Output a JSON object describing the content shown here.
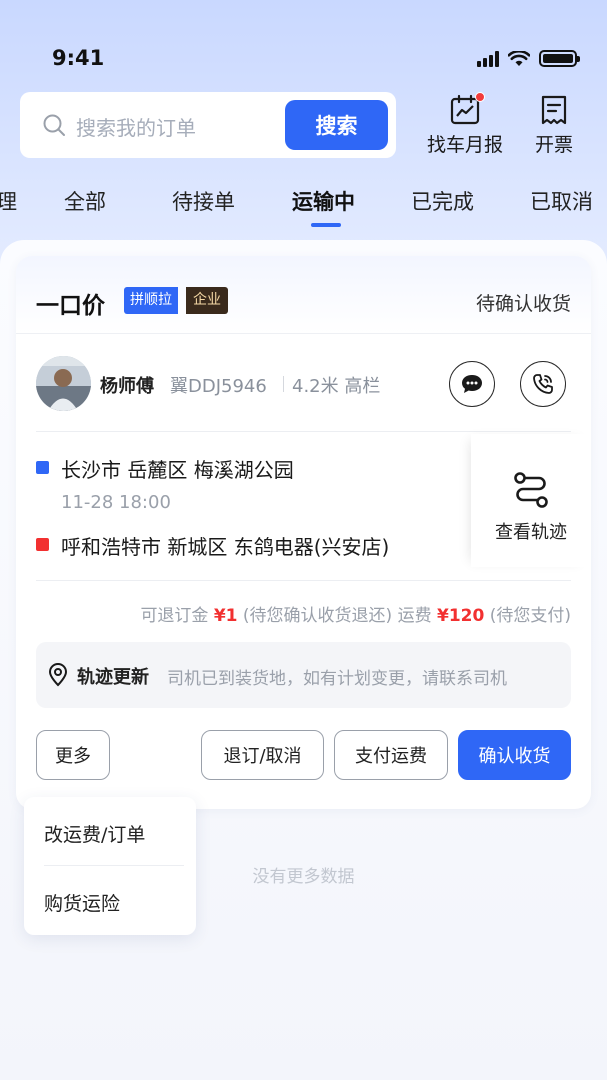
{
  "status_bar": {
    "time": "9:41"
  },
  "search": {
    "placeholder": "搜索我的订单",
    "button_label": "搜索"
  },
  "top_actions": [
    {
      "label": "找车月报",
      "icon": "chart-calendar-icon",
      "has_badge": true
    },
    {
      "label": "开票",
      "icon": "invoice-icon",
      "has_badge": false
    }
  ],
  "tabs": [
    {
      "label": "理",
      "active": false
    },
    {
      "label": "全部",
      "active": false
    },
    {
      "label": "待接单",
      "active": false
    },
    {
      "label": "运输中",
      "active": true
    },
    {
      "label": "已完成",
      "active": false
    },
    {
      "label": "已取消",
      "active": false
    }
  ],
  "order": {
    "price_type": "一口价",
    "badge_pin": "拼顺拉",
    "badge_enterprise": "企业",
    "status": "待确认收货",
    "driver": {
      "name": "杨师傅",
      "plate": "翼DDJ5946",
      "truck": "4.2米 高栏"
    },
    "route": {
      "origin": "长沙市 岳麓区 梅溪湖公园",
      "time": "11-28 18:00",
      "destination": "呼和浩特市 新城区 东鸽电器(兴安店)"
    },
    "track_label": "查看轨迹",
    "fees": {
      "refund_label": "可退订金",
      "refund_amount": "¥1",
      "refund_note": "(待您确认收货退还)",
      "freight_label": "运费",
      "freight_amount": "¥120",
      "freight_note": "(待您支付)"
    },
    "notice": {
      "title": "轨迹更新",
      "text": "司机已到装货地，如有计划变更，请联系司机"
    },
    "buttons": {
      "more": "更多",
      "cancel": "退订/取消",
      "pay": "支付运费",
      "confirm": "确认收货"
    }
  },
  "more_menu": [
    "改运费/订单",
    "购货运险"
  ],
  "footer_text": "没有更多数据",
  "colors": {
    "accent": "#2f67f6",
    "origin_marker": "#2f67f6",
    "destination_marker": "#f23030",
    "price_red": "#f23030"
  }
}
